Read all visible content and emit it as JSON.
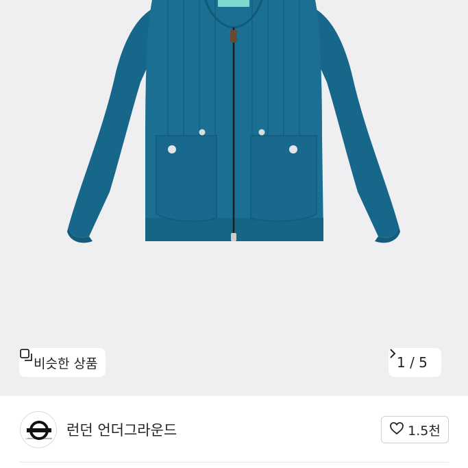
{
  "product_image": {
    "subject": "teal quilted zip-up jacket",
    "background_color": "#efeff1",
    "garment_color": "#1a6f93"
  },
  "similar_button": {
    "label": "비슷한 상품",
    "icon": "similar-items-icon"
  },
  "image_counter": {
    "text": "1 / 5",
    "icon": "chevron-right-icon"
  },
  "seller": {
    "name": "런던 언더그라운드",
    "avatar_logo_text": "LONDON UNDERGROUND"
  },
  "like_button": {
    "count": "1.5천",
    "icon": "heart-outline-icon"
  }
}
